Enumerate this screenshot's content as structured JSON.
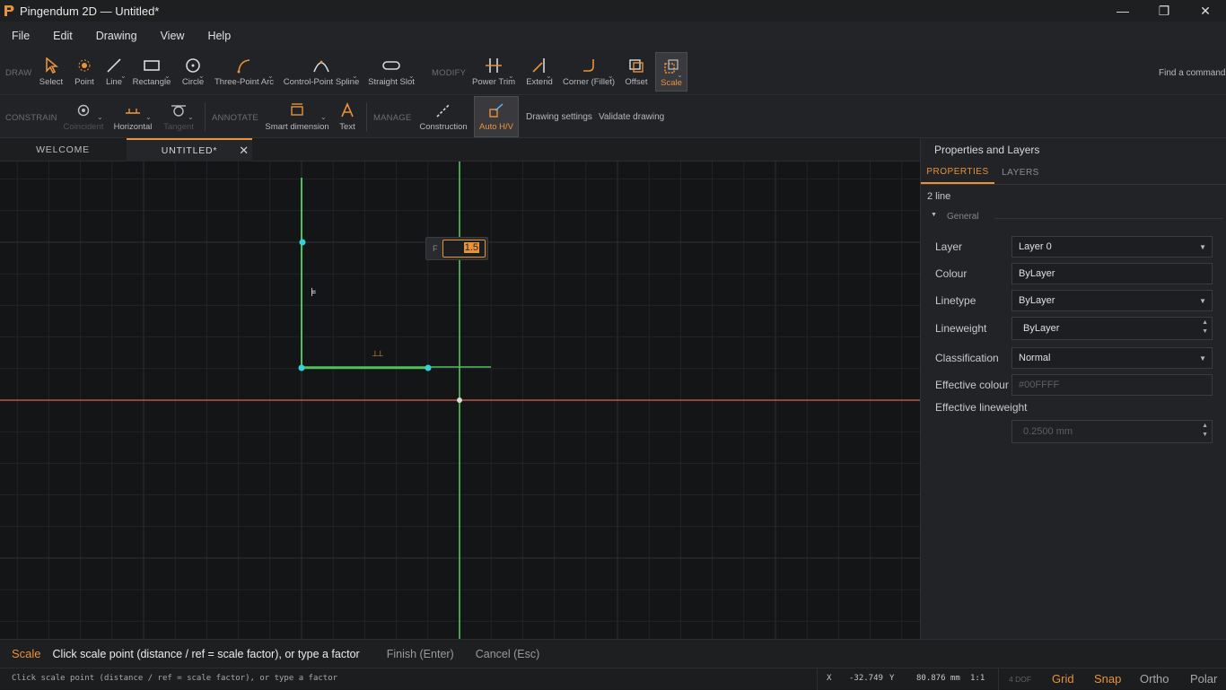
{
  "window": {
    "title": "Pingendum 2D — Untitled*",
    "minimize": "—",
    "restore": "❐",
    "close": "✕"
  },
  "menu": [
    "File",
    "Edit",
    "Drawing",
    "View",
    "Help"
  ],
  "ribbon": {
    "draw_label": "DRAW",
    "modify_label": "MODIFY",
    "constrain_label": "CONSTRAIN",
    "annotate_label": "ANNOTATE",
    "manage_label": "MANAGE",
    "find_command": "Find a command",
    "draw_tools": {
      "select": "Select",
      "point": "Point",
      "line": "Line",
      "rectangle": "Rectangle",
      "circle": "Circle",
      "three_point_arc": "Three-Point Arc",
      "control_point_spline": "Control-Point Spline",
      "straight_slot": "Straight Slot"
    },
    "modify_tools": {
      "power_trim": "Power Trim",
      "extend": "Extend",
      "corner": "Corner (Fillet)",
      "offset": "Offset",
      "scale": "Scale"
    },
    "constrain_tools": {
      "coincident": "Coincident",
      "horizontal": "Horizontal",
      "tangent": "Tangent"
    },
    "annotate_tools": {
      "smart_dimension": "Smart dimension",
      "text": "Text"
    },
    "manage_tools": {
      "construction": "Construction",
      "auto_hv": "Auto H/V",
      "drawing_settings": "Drawing settings",
      "validate_drawing": "Validate drawing"
    }
  },
  "tabs": {
    "welcome": "WELCOME",
    "untitled": "UNTITLED*",
    "close": "✕"
  },
  "canvas": {
    "factor_label": "F",
    "factor_value": "1.5",
    "constraint_vertical_glyph": "⊧",
    "constraint_horizontal_glyph": "⊥⊥"
  },
  "panel": {
    "title": "Properties and Layers",
    "tab_properties": "PROPERTIES",
    "tab_layers": "LAYERS",
    "selection": "2 line",
    "group": "General",
    "rows": {
      "layer_label": "Layer",
      "layer_value": "Layer 0",
      "colour_label": "Colour",
      "colour_value": "ByLayer",
      "linetype_label": "Linetype",
      "linetype_value": "ByLayer",
      "lineweight_label": "Lineweight",
      "lineweight_value": "ByLayer",
      "classification_label": "Classification",
      "classification_value": "Normal",
      "effective_colour_label": "Effective colour",
      "effective_colour_value": "#00FFFF",
      "effective_lineweight_label": "Effective lineweight",
      "effective_lineweight_value": "0.2500 mm"
    }
  },
  "command": {
    "tool": "Scale",
    "prompt": "Click scale point (distance / ref = scale factor), or type a factor",
    "finish": "Finish (Enter)",
    "cancel": "Cancel (Esc)"
  },
  "status": {
    "message": "Click scale point (distance / ref = scale factor), or type a factor",
    "x_label": "X",
    "x_value": "-32.749",
    "y_label": "Y",
    "y_value": "80.876 mm",
    "scale": "1:1",
    "dof": "4 DOF",
    "grid": "Grid",
    "snap": "Snap",
    "ortho": "Ortho",
    "polar": "Polar"
  },
  "colors": {
    "accent": "#e8923a",
    "geometry": "#4ec25b",
    "point": "#36d1d6",
    "axis_x": "#d9634b",
    "axis_y": "#55c45f"
  }
}
